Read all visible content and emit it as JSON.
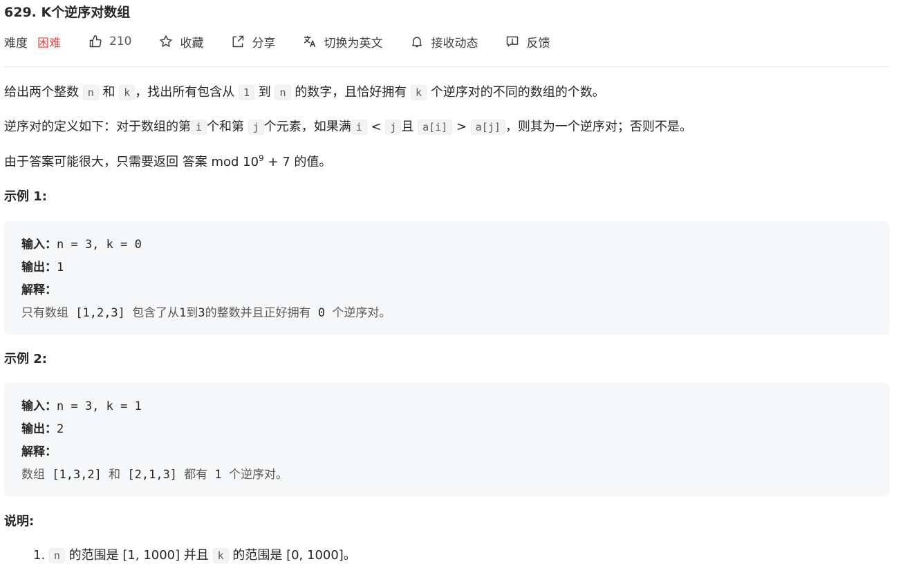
{
  "problem": {
    "title": "629. K个逆序对数组"
  },
  "meta": {
    "difficulty_label": "难度",
    "difficulty_value": "困难",
    "likes": "210",
    "favorite": "收藏",
    "share": "分享",
    "switch_lang": "切换为英文",
    "notify": "接收动态",
    "feedback": "反馈"
  },
  "colors": {
    "difficulty_hard": "#ef4743",
    "code_bg": "#f6f7f8",
    "divider": "#e8e8e8"
  },
  "desc": {
    "p1": {
      "a": "给出两个整数 ",
      "c1": "n",
      "b": " 和 ",
      "c2": "k",
      "c": "，找出所有包含从 ",
      "c3": "1",
      "d": " 到 ",
      "c4": "n",
      "e": " 的数字，且恰好拥有 ",
      "c5": "k",
      "f": " 个逆序对的不同的数组的个数。"
    },
    "p2": {
      "a": "逆序对的定义如下：对于数组的第",
      "c1": "i",
      "b": "个和第 ",
      "c2": "j",
      "c": "个元素，如果满",
      "c3": "i",
      "d": " < ",
      "c4": "j",
      "e": "且 ",
      "c5": "a[i]",
      "f": " > ",
      "c6": "a[j]",
      "g": "，则其为一个逆序对；否则不是。"
    },
    "p3": {
      "a": "由于答案可能很大，只需要返回 答案 mod 10",
      "sup": "9",
      "b": " + 7 的值。"
    }
  },
  "examples": [
    {
      "heading": "示例 1:",
      "input_label": "输入：",
      "input": "n = 3, k = 0",
      "output_label": "输出：",
      "output": "1",
      "explain_label": "解释：",
      "explain": {
        "a": "只有数组 ",
        "b": "[1,2,3]",
        "c": " 包含了从",
        "d": "1",
        "e": "到",
        "f": "3",
        "g": "的整数并且正好拥有 ",
        "h": "0",
        "i": " 个逆序对。"
      }
    },
    {
      "heading": "示例 2:",
      "input_label": "输入：",
      "input": "n = 3, k = 1",
      "output_label": "输出：",
      "output": "2",
      "explain_label": "解释：",
      "explain": {
        "a": "数组 ",
        "b": "[1,3,2]",
        "c": " 和 ",
        "d": "[2,1,3]",
        "e": " 都有 ",
        "f": "1",
        "g": " 个逆序对。"
      }
    }
  ],
  "notes": {
    "heading": "说明:",
    "items": [
      {
        "num": "1.",
        "c1": "n",
        "a": " 的范围是 [1, 1000] 并且 ",
        "c2": "k",
        "b": " 的范围是 [0, 1000]。"
      }
    ]
  }
}
